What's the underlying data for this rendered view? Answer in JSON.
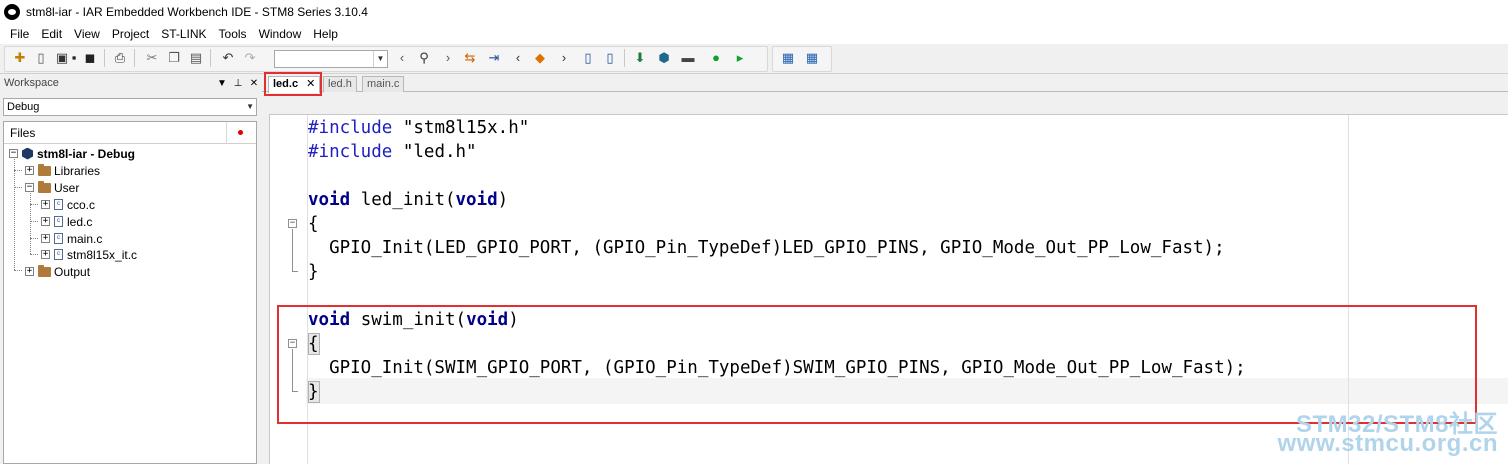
{
  "window": {
    "title": "stm8l-iar - IAR Embedded Workbench IDE - STM8 Series 3.10.4"
  },
  "menu": [
    "File",
    "Edit",
    "View",
    "Project",
    "ST-LINK",
    "Tools",
    "Window",
    "Help"
  ],
  "toolbar": {
    "combo_value": "",
    "icons": [
      "new-file-icon",
      "new-icon",
      "open-icon",
      "save-icon",
      "save-all-icon",
      "print-icon",
      "cut-icon",
      "copy-icon",
      "paste-icon",
      "undo-icon",
      "redo-icon",
      "nav-back-icon",
      "find-icon",
      "nav-forward-icon",
      "toggle-bookmark-icon",
      "goto-icon",
      "prev-bookmark-icon",
      "bookmark-icon",
      "next-bookmark-icon",
      "prev-page-icon",
      "next-page-icon",
      "download-icon",
      "download-debug-icon",
      "breakpoint-icon",
      "run-icon",
      "debug-run-icon",
      "make-icon",
      "build-icon"
    ]
  },
  "workspace": {
    "title": "Workspace",
    "config": "Debug",
    "files_label": "Files",
    "tree": {
      "project": "stm8l-iar - Debug",
      "libraries": "Libraries",
      "user": "User",
      "files": [
        "cco.c",
        "led.c",
        "main.c",
        "stm8l15x_it.c"
      ],
      "output": "Output"
    }
  },
  "tabs": [
    "led.c",
    "led.h",
    "main.c"
  ],
  "code": {
    "line1_kw": "#include",
    "line1_str": " \"stm8l15x.h\"",
    "line2_kw": "#include",
    "line2_str": " \"led.h\"",
    "line3_kw1": "void",
    "line3_mid": " led_init(",
    "line3_kw2": "void",
    "line3_end": ")",
    "line4": "{",
    "line5": "  GPIO_Init(LED_GPIO_PORT, (GPIO_Pin_TypeDef)LED_GPIO_PINS, GPIO_Mode_Out_PP_Low_Fast);",
    "line6": "}",
    "line7_kw1": "void",
    "line7_mid": " swim_init(",
    "line7_kw2": "void",
    "line7_end": ")",
    "line8": "{",
    "line9": "  GPIO_Init(SWIM_GPIO_PORT, (GPIO_Pin_TypeDef)SWIM_GPIO_PINS, GPIO_Mode_Out_PP_Low_Fast);",
    "line10": "}"
  },
  "watermark": {
    "line1": "STM32/STM8社区",
    "line2": "www.stmcu.org.cn"
  },
  "colors": {
    "highlight": "#e03030",
    "keyword": "#00008b",
    "preprocessor": "#2020c0"
  }
}
